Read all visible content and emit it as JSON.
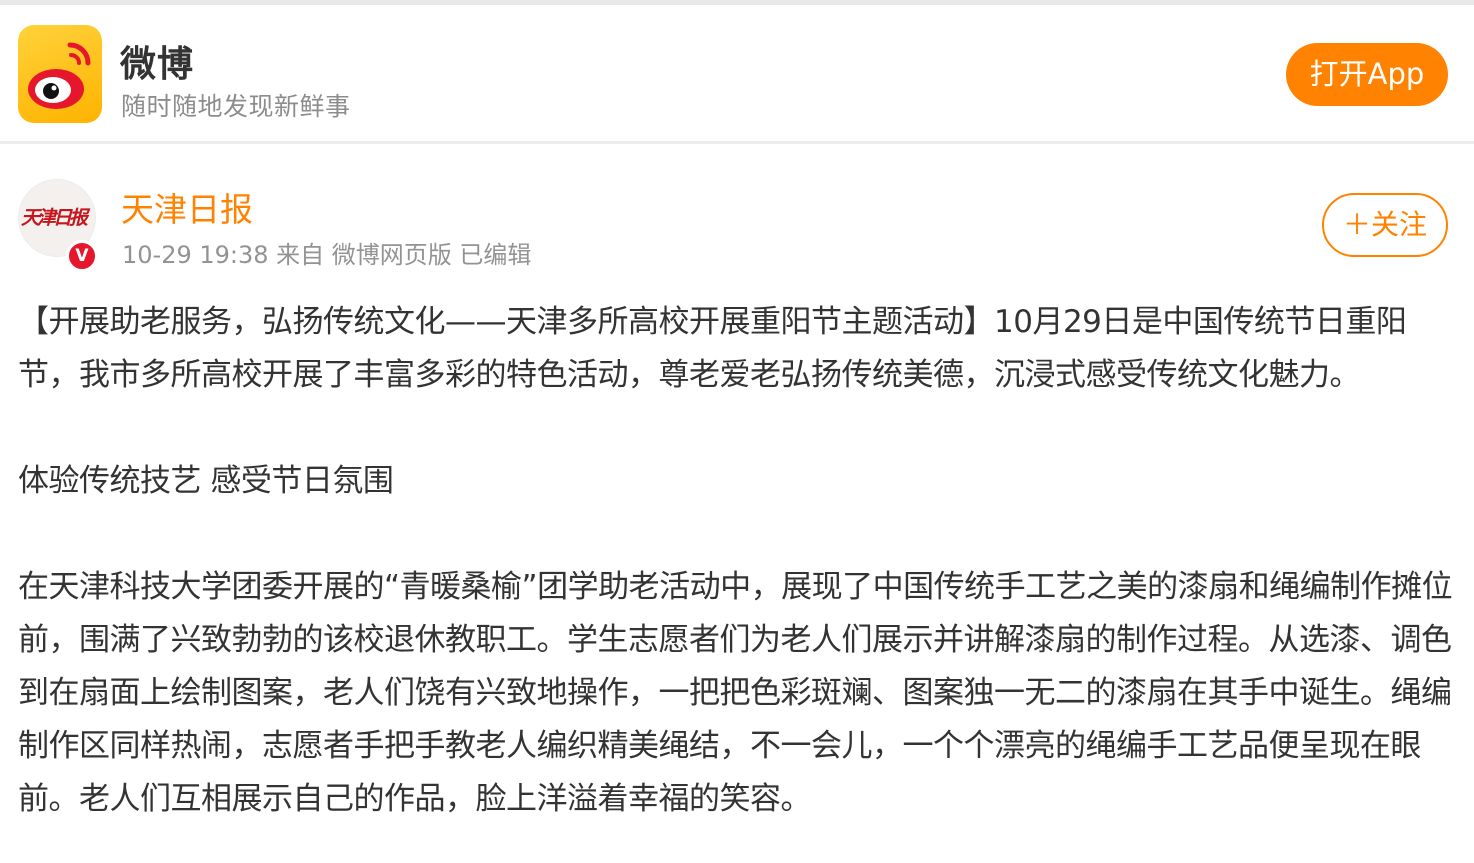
{
  "banner": {
    "app_name": "微博",
    "slogan": "随时随地发现新鲜事",
    "open_app_label": "打开App"
  },
  "post": {
    "author": "天津日报",
    "avatar_text": "天津日报",
    "verified_mark": "V",
    "meta": "10-29 19:38 来自 微博网页版 已编辑",
    "follow_label": "＋关注",
    "paragraphs": [
      "【开展助老服务，弘扬传统文化——天津多所高校开展重阳节主题活动】10月29日是中国传统节日重阳节，我市多所高校开展了丰富多彩的特色活动，尊老爱老弘扬传统美德，沉浸式感受传统文化魅力。",
      "体验传统技艺 感受节日氛围",
      "在天津科技大学团委开展的“青暖桑榆”团学助老活动中，展现了中国传统手工艺之美的漆扇和绳编制作摊位前，围满了兴致勃勃的该校退休教职工。学生志愿者们为老人们展示并讲解漆扇的制作过程。从选漆、调色到在扇面上绘制图案，老人们饶有兴致地操作，一把把色彩斑斓、图案独一无二的漆扇在其手中诞生。绳编制作区同样热闹，志愿者手把手教老人编织精美绳结，不一会儿，一个个漂亮的绳编手工艺品便呈现在眼前。老人们互相展示自己的作品，脸上洋溢着幸福的笑容。"
    ]
  },
  "colors": {
    "brand_orange": "#ff8200",
    "verified_red": "#e6162d",
    "meta_gray": "#939393"
  },
  "icons": {
    "app_logo": "weibo-logo-icon",
    "verified": "verified-badge-icon"
  }
}
